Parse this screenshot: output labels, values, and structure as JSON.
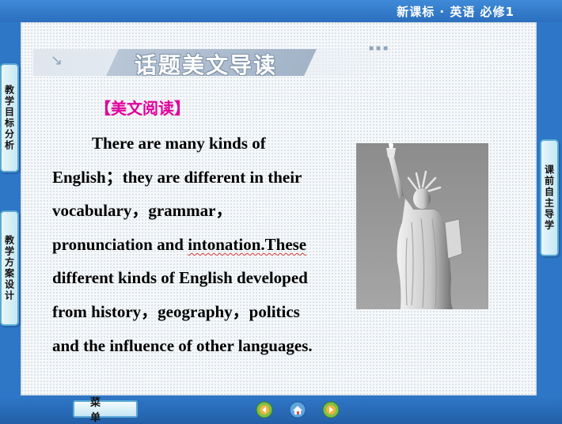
{
  "header": {
    "title": "新课标 · 英语  必修1"
  },
  "banner": {
    "title": "话题美文导读"
  },
  "section": {
    "heading": "【美文阅读】"
  },
  "passage": {
    "lines": [
      "There are many kinds of",
      "English；they are different in their",
      "vocabulary，grammar，",
      "pronunciation and ",
      "intonation.These",
      "different kinds of English developed",
      "from history，geography，politics",
      "and the influence of other languages."
    ]
  },
  "side_tabs": {
    "left": [
      "教学目标分析",
      "教学方案设计"
    ],
    "right": [
      "课前自主导学"
    ]
  },
  "bottom": {
    "menu_label": "菜单",
    "nav_icons": [
      "back-icon",
      "home-icon",
      "forward-icon"
    ]
  },
  "colors": {
    "frame": "#2e77c7",
    "heading": "#e0009a",
    "tab_border": "#5aa9d6"
  }
}
